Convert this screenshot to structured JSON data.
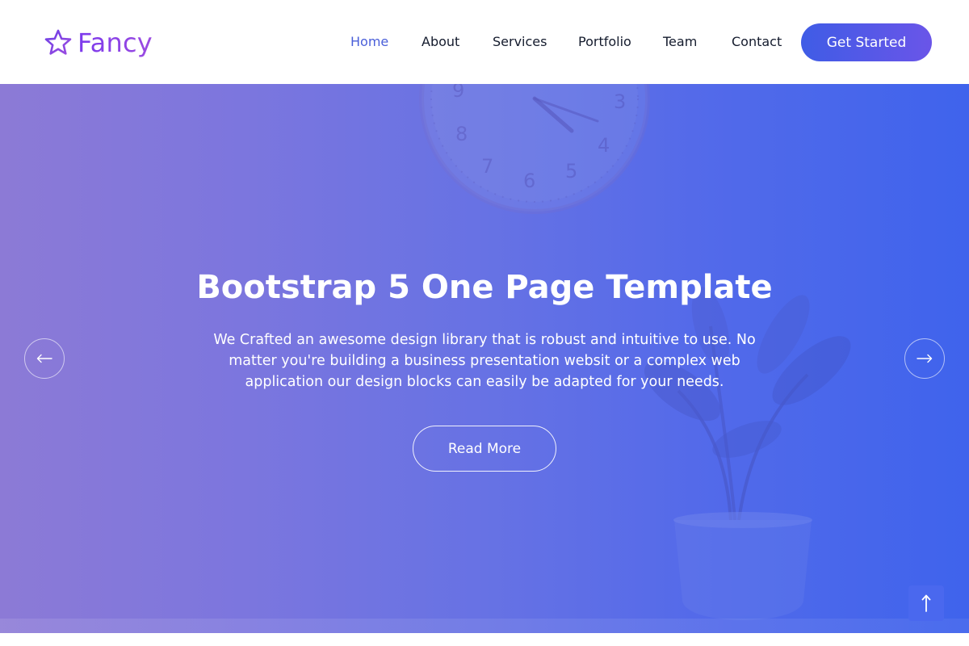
{
  "brand": {
    "name": "Fancy",
    "logo_icon": "star-outline-icon",
    "gradient_start": "#7c3aed",
    "gradient_end": "#9b4be0"
  },
  "nav": {
    "items": [
      {
        "label": "Home",
        "active": true
      },
      {
        "label": "About",
        "active": false
      },
      {
        "label": "Services",
        "active": false
      },
      {
        "label": "Portfolio",
        "active": false
      },
      {
        "label": "Team",
        "active": false
      },
      {
        "label": "Contact",
        "active": false
      }
    ],
    "cta_label": "Get Started",
    "active_color": "#4a5fd9"
  },
  "hero": {
    "title": "Bootstrap 5 One Page Template",
    "description": "We Crafted an awesome design library that is robust and intuitive to use. No matter you're building a business presentation websit or a complex web application our design blocks can easily be adapted for your needs.",
    "button_label": "Read More",
    "prev_icon": "arrow-left-icon",
    "next_icon": "arrow-right-icon",
    "gradient_start": "#8a78d6",
    "gradient_end": "#3c60ec"
  },
  "scroll_top": {
    "icon": "arrow-up-icon",
    "color": "#4a68ee"
  }
}
